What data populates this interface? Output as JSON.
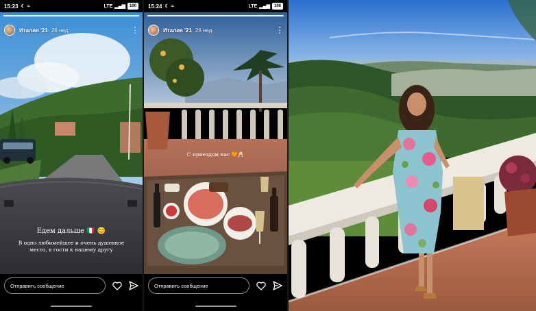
{
  "stories": [
    {
      "status_time": "15:23",
      "battery": "100",
      "network": "LTE",
      "username": "Италия '21",
      "age": "26 нед.",
      "caption_title": "Едем дальше",
      "caption_title_emoji": "🇮🇹 😊",
      "caption_text": "В одно любимейшее и очень душевное место, в гости к нашему другу",
      "reply_placeholder": "Отправить сообщение",
      "progress": 1.0
    },
    {
      "status_time": "15:24",
      "battery": "100",
      "network": "LTE",
      "username": "Италия '21",
      "age": "26 нед.",
      "overlay_text": "С приездом нас 🧡🥂",
      "reply_placeholder": "Отправить сообщение",
      "progress": 1.0
    }
  ],
  "icons": {
    "like": "heart-icon",
    "share": "send-icon",
    "more": "more-icon"
  }
}
